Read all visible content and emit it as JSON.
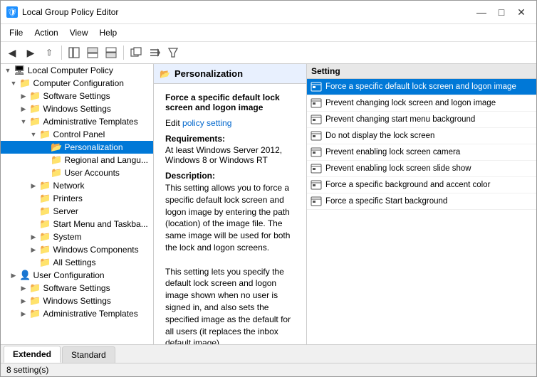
{
  "window": {
    "title": "Local Group Policy Editor",
    "icon": "🛡"
  },
  "titleBtns": {
    "minimize": "—",
    "maximize": "□",
    "close": "✕"
  },
  "menu": [
    "File",
    "Action",
    "View",
    "Help"
  ],
  "toolbar": {
    "buttons": [
      "◀",
      "▶",
      "⬆",
      "📁",
      "📋",
      "📄",
      "🔄",
      "🗑",
      "⊞",
      "📊",
      "🔽"
    ]
  },
  "tree": {
    "items": [
      {
        "id": "local-computer-policy",
        "label": "Local Computer Policy",
        "indent": 0,
        "expanded": true,
        "icon": "🖥",
        "hasExpand": true
      },
      {
        "id": "computer-configuration",
        "label": "Computer Configuration",
        "indent": 1,
        "expanded": true,
        "icon": "📁",
        "hasExpand": true
      },
      {
        "id": "software-settings",
        "label": "Software Settings",
        "indent": 2,
        "expanded": false,
        "icon": "📁",
        "hasExpand": true
      },
      {
        "id": "windows-settings",
        "label": "Windows Settings",
        "indent": 2,
        "expanded": false,
        "icon": "📁",
        "hasExpand": true
      },
      {
        "id": "administrative-templates",
        "label": "Administrative Templates",
        "indent": 2,
        "expanded": true,
        "icon": "📁",
        "hasExpand": true
      },
      {
        "id": "control-panel",
        "label": "Control Panel",
        "indent": 3,
        "expanded": true,
        "icon": "📁",
        "hasExpand": true
      },
      {
        "id": "personalization",
        "label": "Personalization",
        "indent": 4,
        "expanded": false,
        "icon": "📂",
        "hasExpand": false,
        "selected": true
      },
      {
        "id": "regional-language",
        "label": "Regional and Langu...",
        "indent": 4,
        "expanded": false,
        "icon": "📁",
        "hasExpand": false
      },
      {
        "id": "user-accounts",
        "label": "User Accounts",
        "indent": 4,
        "expanded": false,
        "icon": "📁",
        "hasExpand": false
      },
      {
        "id": "network",
        "label": "Network",
        "indent": 3,
        "expanded": false,
        "icon": "📁",
        "hasExpand": true
      },
      {
        "id": "printers",
        "label": "Printers",
        "indent": 3,
        "expanded": false,
        "icon": "📁",
        "hasExpand": false
      },
      {
        "id": "server",
        "label": "Server",
        "indent": 3,
        "expanded": false,
        "icon": "📁",
        "hasExpand": false
      },
      {
        "id": "start-menu-taskbar",
        "label": "Start Menu and Taskba...",
        "indent": 3,
        "expanded": false,
        "icon": "📁",
        "hasExpand": false
      },
      {
        "id": "system",
        "label": "System",
        "indent": 3,
        "expanded": false,
        "icon": "📁",
        "hasExpand": true
      },
      {
        "id": "windows-components",
        "label": "Windows Components",
        "indent": 3,
        "expanded": false,
        "icon": "📁",
        "hasExpand": true
      },
      {
        "id": "all-settings",
        "label": "All Settings",
        "indent": 3,
        "expanded": false,
        "icon": "📁",
        "hasExpand": false
      },
      {
        "id": "user-configuration",
        "label": "User Configuration",
        "indent": 1,
        "expanded": false,
        "icon": "👤",
        "hasExpand": true
      },
      {
        "id": "software-settings-user",
        "label": "Software Settings",
        "indent": 2,
        "expanded": false,
        "icon": "📁",
        "hasExpand": true
      },
      {
        "id": "windows-settings-user",
        "label": "Windows Settings",
        "indent": 2,
        "expanded": false,
        "icon": "📁",
        "hasExpand": true
      },
      {
        "id": "admin-templates-user",
        "label": "Administrative Templates",
        "indent": 2,
        "expanded": false,
        "icon": "📁",
        "hasExpand": true
      }
    ]
  },
  "middlePanel": {
    "headerIcon": "📂",
    "headerTitle": "Personalization",
    "settingTitle": "Force a specific default lock screen and logon image",
    "editLabel": "Edit",
    "policyLink": "policy setting",
    "requirementsLabel": "Requirements:",
    "requirementsText": "At least Windows Server 2012, Windows 8 or Windows RT",
    "descriptionLabel": "Description:",
    "descriptionText": "This setting allows you to force a specific default lock screen and logon image by entering the path (location) of the image file. The same image will be used for both the lock and logon screens.\n\nThis setting lets you specify the default lock screen and logon image shown when no user is signed in, and also sets the specified image as the default for all users (it replaces the inbox default image)."
  },
  "rightPanel": {
    "headerLabel": "Setting",
    "settings": [
      {
        "id": "s1",
        "label": "Force a specific default lock screen and logon image",
        "selected": true
      },
      {
        "id": "s2",
        "label": "Prevent changing lock screen and logon image",
        "selected": false
      },
      {
        "id": "s3",
        "label": "Prevent changing start menu background",
        "selected": false
      },
      {
        "id": "s4",
        "label": "Do not display the lock screen",
        "selected": false
      },
      {
        "id": "s5",
        "label": "Prevent enabling lock screen camera",
        "selected": false
      },
      {
        "id": "s6",
        "label": "Prevent enabling lock screen slide show",
        "selected": false
      },
      {
        "id": "s7",
        "label": "Force a specific background and accent color",
        "selected": false
      },
      {
        "id": "s8",
        "label": "Force a specific Start background",
        "selected": false
      }
    ]
  },
  "tabs": [
    {
      "id": "extended",
      "label": "Extended",
      "active": true
    },
    {
      "id": "standard",
      "label": "Standard",
      "active": false
    }
  ],
  "statusBar": {
    "text": "8 setting(s)"
  },
  "colors": {
    "selected_bg": "#0078d7",
    "selected_text": "#ffffff",
    "accent": "#0066cc"
  }
}
